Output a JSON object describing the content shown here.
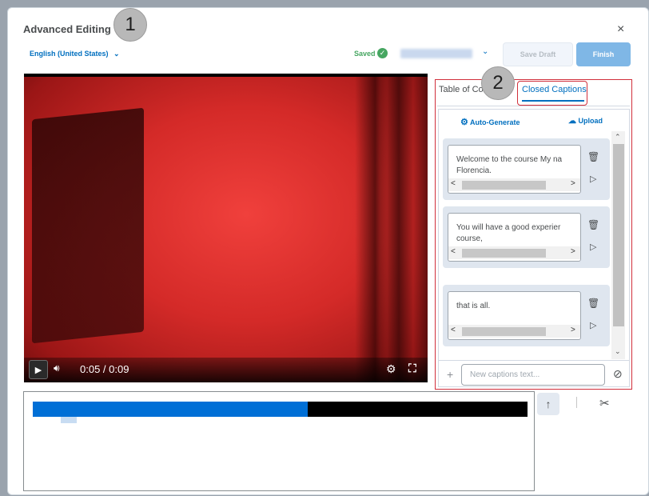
{
  "dialog": {
    "title": "Advanced Editing",
    "close_icon": "×",
    "language": "English (United States)",
    "saved_label": "Saved",
    "version_selected": "",
    "save_draft_label": "Save Draft",
    "finish_label": "Finish"
  },
  "markers": {
    "m1": "1",
    "m2": "2"
  },
  "video": {
    "time": "0:05 / 0:09",
    "progress_fraction": 0.556
  },
  "panel": {
    "tab_toc": "Table of Contents",
    "tab_cc": "Closed Captions",
    "auto_generate": "Auto-Generate",
    "upload": "Upload",
    "captions": [
      {
        "text": "Welcome to the course My na\nFlorencia."
      },
      {
        "text": "You will have a good experier\ncourse,"
      },
      {
        "text": "that is all."
      }
    ],
    "new_caption_placeholder": "New captions text..."
  },
  "colors": {
    "accent": "#006fbf",
    "saved_green": "#46a661",
    "highlight_red": "#d12f3b",
    "timeline_fill": "#006fd6"
  }
}
